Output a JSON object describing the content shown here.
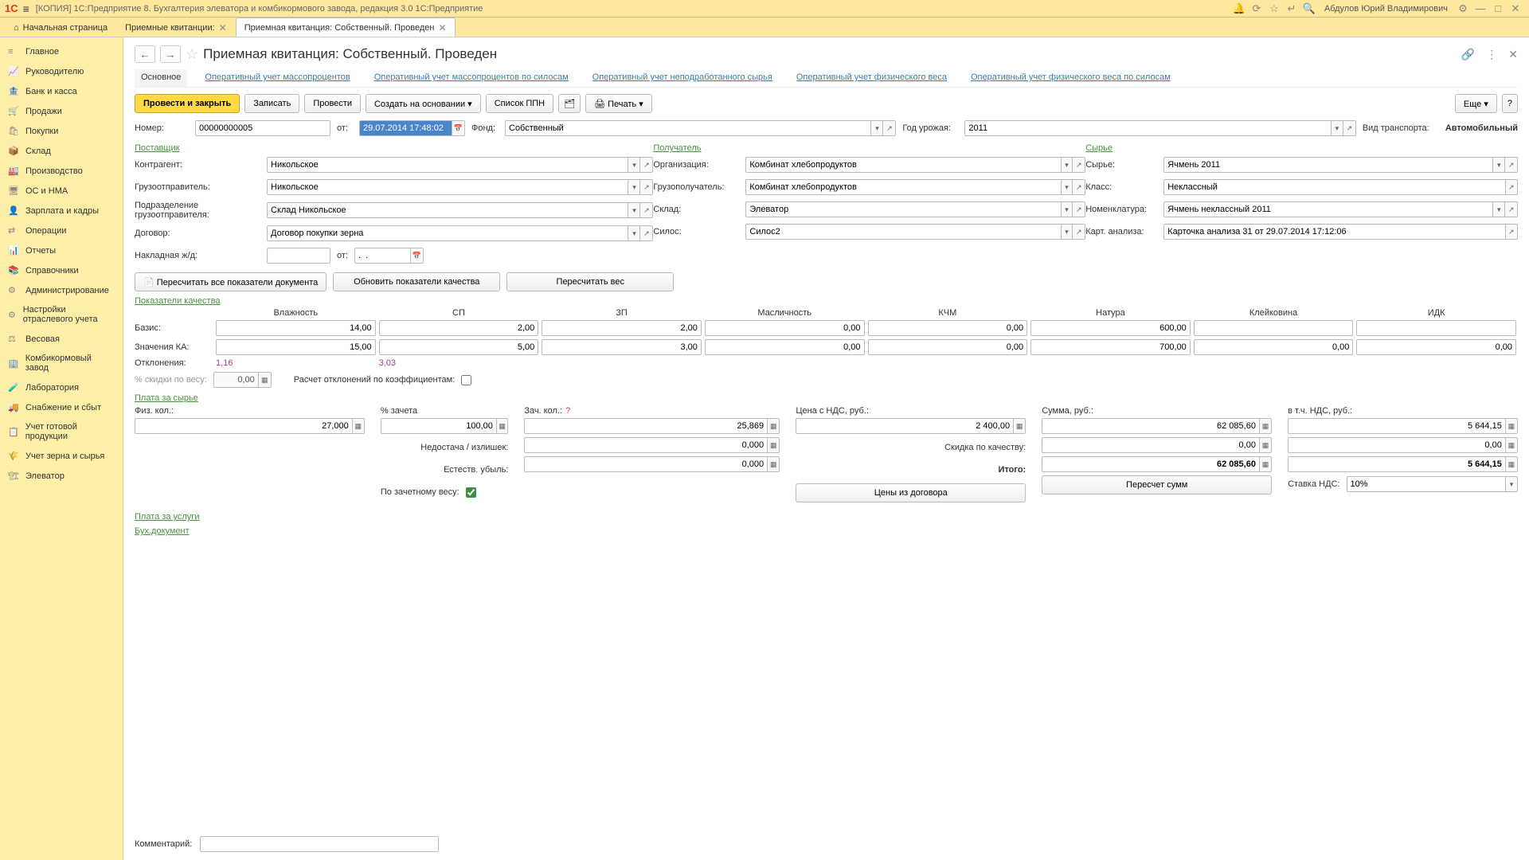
{
  "titlebar": {
    "title": "[КОПИЯ] 1С:Предприятие 8. Бухгалтерия элеватора и комбикормового завода, редакция 3.0 1С:Предприятие",
    "user": "Абдулов Юрий Владимирович"
  },
  "tabs": [
    {
      "label": "Начальная страница",
      "home": true
    },
    {
      "label": "Приемные квитанции:",
      "closable": true
    },
    {
      "label": "Приемная квитанция: Собственный. Проведен",
      "closable": true,
      "active": true
    }
  ],
  "sidebar": [
    {
      "icon": "≡",
      "label": "Главное"
    },
    {
      "icon": "📈",
      "label": "Руководителю"
    },
    {
      "icon": "🏦",
      "label": "Банк и касса"
    },
    {
      "icon": "🛒",
      "label": "Продажи"
    },
    {
      "icon": "🛍",
      "label": "Покупки"
    },
    {
      "icon": "📦",
      "label": "Склад"
    },
    {
      "icon": "🏭",
      "label": "Производство"
    },
    {
      "icon": "🖥",
      "label": "ОС и НМА"
    },
    {
      "icon": "👤",
      "label": "Зарплата и кадры"
    },
    {
      "icon": "⇄",
      "label": "Операции"
    },
    {
      "icon": "📊",
      "label": "Отчеты"
    },
    {
      "icon": "📚",
      "label": "Справочники"
    },
    {
      "icon": "⚙",
      "label": "Администрирование"
    },
    {
      "icon": "⚙",
      "label": "Настройки отраслевого учета"
    },
    {
      "icon": "⚖",
      "label": "Весовая"
    },
    {
      "icon": "🏢",
      "label": "Комбикормовый завод"
    },
    {
      "icon": "🧪",
      "label": "Лаборатория"
    },
    {
      "icon": "🚚",
      "label": "Снабжение и сбыт"
    },
    {
      "icon": "📋",
      "label": "Учет готовой продукции"
    },
    {
      "icon": "🌾",
      "label": "Учет зерна и сырья"
    },
    {
      "icon": "🏗",
      "label": "Элеватор"
    }
  ],
  "doc": {
    "title": "Приемная квитанция: Собственный. Проведен",
    "subtabs": [
      {
        "label": "Основное",
        "active": true
      },
      {
        "label": "Оперативный учет массопроцентов"
      },
      {
        "label": "Оперативный учет массопроцентов по силосам"
      },
      {
        "label": "Оперативный учет неподработанного сырья"
      },
      {
        "label": "Оперативный учет физического веса"
      },
      {
        "label": "Оперативный учет физического веса по силосам"
      }
    ],
    "toolbar": {
      "post_close": "Провести и закрыть",
      "save": "Записать",
      "post": "Провести",
      "create_based": "Создать на основании",
      "ppn_list": "Список ППН",
      "print": "Печать",
      "more": "Еще",
      "help": "?"
    },
    "fields": {
      "number_lbl": "Номер:",
      "number": "00000000005",
      "date_lbl": "от:",
      "date": "29.07.2014 17:48:02",
      "fund_lbl": "Фонд:",
      "fund": "Собственный",
      "year_lbl": "Год урожая:",
      "year": "2011",
      "transport_lbl": "Вид транспорта:",
      "transport": "Автомобильный"
    },
    "supplier": {
      "title": "Поставщик",
      "contragent_lbl": "Контрагент:",
      "contragent": "Никольское",
      "shipper_lbl": "Грузоотправитель:",
      "shipper": "Никольское",
      "dept_lbl": "Подразделение грузоотправителя:",
      "dept": "Склад Никольское",
      "contract_lbl": "Договор:",
      "contract": "Договор покупки зерна",
      "waybill_lbl": "Накладная ж/д:",
      "waybill": "",
      "waybill_date_lbl": "от:",
      "waybill_date": ".  ."
    },
    "recipient": {
      "title": "Получатель",
      "org_lbl": "Организация:",
      "org": "Комбинат хлебопродуктов",
      "consignee_lbl": "Грузополучатель:",
      "consignee": "Комбинат хлебопродуктов",
      "warehouse_lbl": "Склад:",
      "warehouse": "Элеватор",
      "silos_lbl": "Силос:",
      "silos": "Силос2"
    },
    "raw": {
      "title": "Сырье",
      "raw_lbl": "Сырье:",
      "raw": "Ячмень 2011",
      "class_lbl": "Класс:",
      "class": "Неклассный",
      "nomen_lbl": "Номенклатура:",
      "nomen": "Ячмень неклассный 2011",
      "card_lbl": "Карт. анализа:",
      "card": "Карточка анализа 31 от 29.07.2014 17:12:06"
    },
    "actions": {
      "recalc_all": "Пересчитать все показатели документа",
      "update_quality": "Обновить показатели качества",
      "recalc_weight": "Пересчитать вес"
    },
    "quality": {
      "title": "Показатели качества",
      "cols": [
        "Влажность",
        "СП",
        "ЗП",
        "Масличность",
        "КЧМ",
        "Натура",
        "Клейковина",
        "ИДК"
      ],
      "rows": {
        "basis_lbl": "Базис:",
        "basis": [
          "14,00",
          "2,00",
          "2,00",
          "0,00",
          "0,00",
          "600,00",
          "",
          ""
        ],
        "ka_lbl": "Значения КА:",
        "ka": [
          "15,00",
          "5,00",
          "3,00",
          "0,00",
          "0,00",
          "700,00",
          "0,00",
          "0,00"
        ],
        "dev_lbl": "Отклонения:",
        "dev": [
          "1,16",
          "3,03",
          "",
          "",
          "",
          "",
          "",
          ""
        ]
      },
      "discount_lbl": "% скидки по весу:",
      "discount": "0,00",
      "coef_lbl": "Расчет отклонений по коэффициентам:"
    },
    "payment": {
      "title": "Плата за сырье",
      "phys_lbl": "Физ. кол.:",
      "phys": "27,000",
      "pct_lbl": "% зачета",
      "pct": "100,00",
      "net_lbl": "Зач. кол.:",
      "net": "25,869",
      "short_lbl": "Недостача / излишек:",
      "short": "0,000",
      "nat_lbl": "Естеств. убыль:",
      "nat": "0,000",
      "by_net_lbl": "По зачетному весу:",
      "price_lbl": "Цена с НДС, руб.:",
      "price": "2 400,00",
      "qual_disc_lbl": "Скидка по качеству:",
      "qual_disc": "0,00",
      "total_lbl": "Итого:",
      "sum_lbl": "Сумма, руб.:",
      "sum": "62 085,60",
      "sum_disc": "0,00",
      "sum_total": "62 085,60",
      "vat_lbl": "в т.ч. НДС, руб.:",
      "vat": "5 644,15",
      "vat_disc": "0,00",
      "vat_total": "5 644,15",
      "prices_btn": "Цены из договора",
      "recalc_btn": "Пересчет сумм",
      "vat_rate_lbl": "Ставка НДС:",
      "vat_rate": "10%"
    },
    "links": {
      "services": "Плата за услуги",
      "accdoc": "Бух.документ"
    },
    "comment_lbl": "Комментарий:"
  }
}
